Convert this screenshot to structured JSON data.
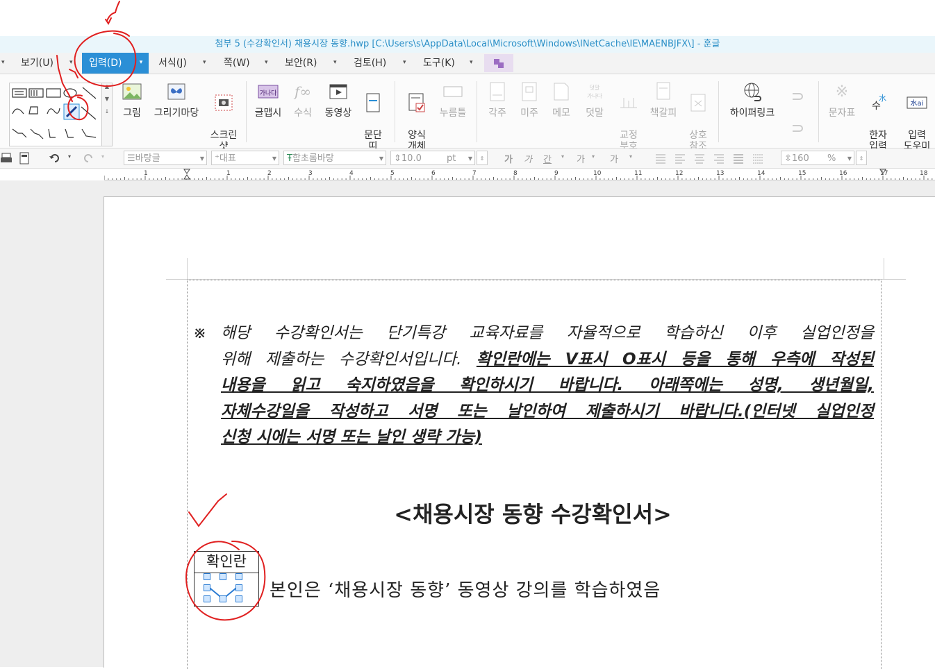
{
  "window": {
    "title": "첨부 5 (수강확인서) 채용시장 동향.hwp [C:\\Users\\s\\AppData\\Local\\Microsoft\\Windows\\INetCache\\IE\\MAENBJFX\\] - 훈글"
  },
  "menu": {
    "items": [
      {
        "label": "보기(U)"
      },
      {
        "label": "입력(D)",
        "active": true
      },
      {
        "label": "서식(J)"
      },
      {
        "label": "쪽(W)"
      },
      {
        "label": "보안(R)"
      },
      {
        "label": "검토(H)"
      },
      {
        "label": "도구(K)"
      }
    ]
  },
  "ribbon": {
    "picture": "그림",
    "drawing_wizard": "그리기마당",
    "screenshot": "스크린\n샷",
    "glyph": "글맵시",
    "formula": "수식",
    "video": "동영상",
    "paragraph_line": "문단\n띠",
    "form_object": "양식\n개체",
    "push_button": "누름틀",
    "footnote": "각주",
    "endnote": "미주",
    "memo": "메모",
    "overlay": "덧말",
    "proofread": "교정\n부호",
    "bookmark": "책갈피",
    "cross_ref": "상호\n참조",
    "hyperlink": "하이퍼링크",
    "char_map": "문자표",
    "hanja_input": "한자\n입력",
    "input_helper": "입력\n도우미"
  },
  "toolbar": {
    "style": "바탕글",
    "lang": "대표",
    "font": "함초롬바탕",
    "size": "10.0",
    "size_unit": "pt",
    "line_spacing": "160",
    "line_unit": "%"
  },
  "ruler": {
    "numbers": [
      "1",
      "1",
      "2",
      "3",
      "4",
      "5",
      "6",
      "7",
      "8",
      "9",
      "10",
      "11",
      "12",
      "13",
      "14",
      "15",
      "16",
      "17",
      "18"
    ]
  },
  "document": {
    "notice_mark": "※",
    "notice_line1": "해당 수강확인서는 단기특강 교육자료를 자율적으로 학습하신 이후 실업인정을",
    "notice_line2_plain": "위해 제출하는 수강확인서입니다. ",
    "notice_line2_bold": "확인란에는 V표시 O표시 등을 통해 우측에 작성된",
    "notice_line3": "내용을 읽고 숙지하였음을 확인하시기 바랍니다. 아래쪽에는 성명, 생년월일,",
    "notice_line4": "자체수강일을 작성하고 서명 또는 날인하여 제출하시기 바랍니다.(인터넷 실업인정",
    "notice_line5": "신청 시에는 서명 또는 날인 생략 가능)",
    "heading": "<채용시장 동향 수강확인서>",
    "confirm_label": "확인란",
    "statement": "본인은 ‘채용시장 동향’ 동영상 강의를 학습하였음"
  },
  "colors": {
    "accent": "#2b8fd6",
    "annotation": "#e02020"
  }
}
